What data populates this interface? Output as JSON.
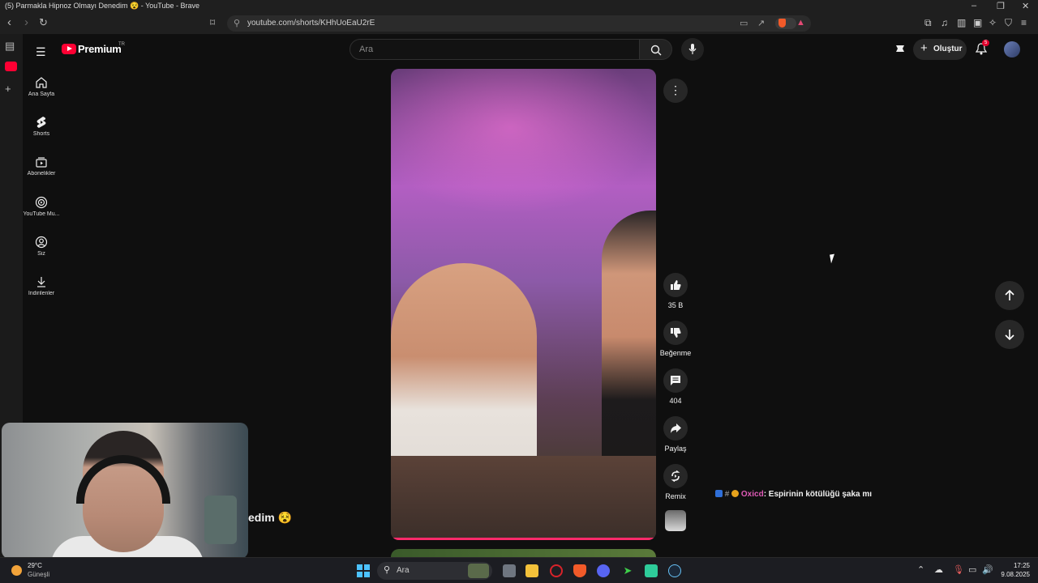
{
  "browser": {
    "window_title": "(5) Parmakla Hipnoz Olmayı Denedim 😵 - YouTube - Brave",
    "url": "youtube.com/shorts/KHhUoEaU2rE"
  },
  "youtube": {
    "logo_text": "Premium",
    "region": "TR",
    "search_placeholder": "Ara",
    "create_label": "Oluştur",
    "notification_count": "5",
    "sidebar": [
      {
        "label": "Ana Sayfa",
        "icon": "home-icon"
      },
      {
        "label": "Shorts",
        "icon": "shorts-icon"
      },
      {
        "label": "Abonelikler",
        "icon": "subscriptions-icon"
      },
      {
        "label": "YouTube Mu...",
        "icon": "youtube-music-icon"
      },
      {
        "label": "Siz",
        "icon": "you-icon"
      },
      {
        "label": "İndirilenler",
        "icon": "download-icon"
      }
    ],
    "actions": {
      "like": "35 B",
      "dislike": "Beğenme",
      "comments": "404",
      "share": "Paylaş",
      "remix": "Remix"
    },
    "short_title_fragment": "edim 😵"
  },
  "overlay_chat": {
    "hash": "#",
    "username": "Oxicd",
    "message": ": Espirinin kötülüğü şaka mı"
  },
  "taskbar": {
    "temperature": "29°C",
    "weather": "Güneşli",
    "search_placeholder": "Ara",
    "time": "17:25",
    "date": "9.08.2025"
  },
  "colors": {
    "yt_red": "#ff0033",
    "background": "#0f0f0f",
    "progress": "#ff2a6a",
    "chat_user": "#e05bb8"
  }
}
